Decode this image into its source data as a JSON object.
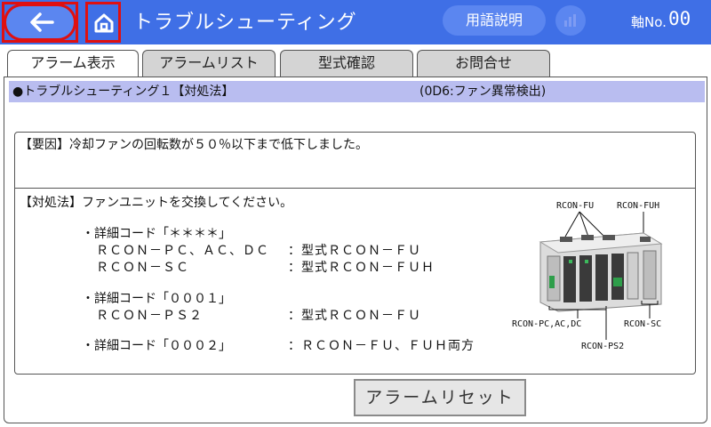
{
  "header": {
    "title": "トラブルシューティング",
    "glossary_label": "用語説明",
    "axis_label": "軸No.",
    "axis_value": "00"
  },
  "tabs": [
    {
      "label": "アラーム表示",
      "active": true
    },
    {
      "label": "アラームリスト",
      "active": false
    },
    {
      "label": "型式確認",
      "active": false
    },
    {
      "label": "お問合せ",
      "active": false
    }
  ],
  "subtitle": {
    "left": "●トラブルシューティング１【対処法】",
    "right": "(0D6:ファン異常検出)"
  },
  "cause": {
    "text": "【要因】冷却ファンの回転数が５０％以下まで低下しました。"
  },
  "solution": {
    "heading": "【対処法】ファンユニットを交換してください。",
    "code1_label": "・詳細コード「＊＊＊＊」",
    "code1_line1_left": "ＲＣＯＮ－ＰＣ、ＡＣ、ＤＣ",
    "code1_line1_right": "：型式ＲＣＯＮ－ＦＵ",
    "code1_line2_left": "ＲＣＯＮ－ＳＣ",
    "code1_line2_right": "：型式ＲＣＯＮ－ＦＵＨ",
    "code2_label": "・詳細コード「０００１」",
    "code2_line1_left": "ＲＣＯＮ－ＰＳ２",
    "code2_line1_right": "：型式ＲＣＯＮ－ＦＵ",
    "code3_label": "・詳細コード「０００２」",
    "code3_right": "：ＲＣＯＮ－ＦＵ、ＦＵＨ両方"
  },
  "device_labels": {
    "fu": "RCON-FU",
    "fuh": "RCON-FUH",
    "pc": "RCON-PC,AC,DC",
    "sc": "RCON-SC",
    "ps2": "RCON-PS2"
  },
  "reset_label": "アラームリセット",
  "colors": {
    "header_bg": "#3f6fe6",
    "button_bg": "#5b86f0",
    "subtitle_bg": "#b9bdf0",
    "highlight_border": "#e01010"
  },
  "icons": [
    "back-arrow-icon",
    "home-icon",
    "chart-icon"
  ]
}
